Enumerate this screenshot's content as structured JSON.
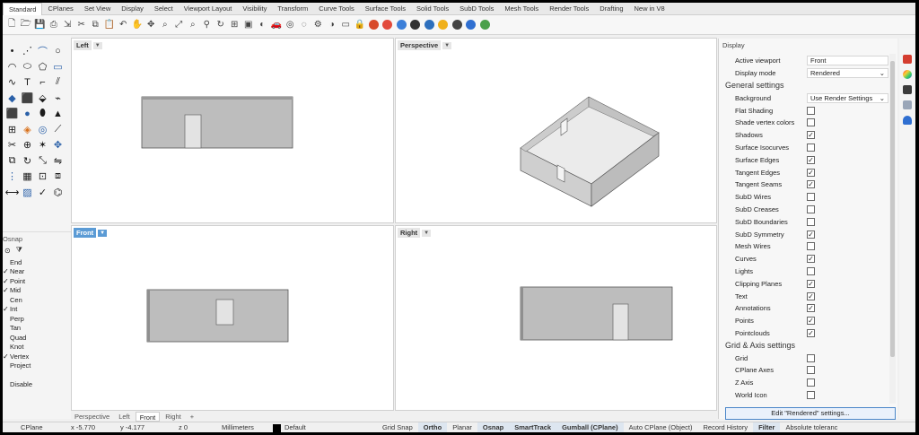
{
  "tabs": [
    "Standard",
    "CPlanes",
    "Set View",
    "Display",
    "Select",
    "Viewport Layout",
    "Visibility",
    "Transform",
    "Curve Tools",
    "Surface Tools",
    "Solid Tools",
    "SubD Tools",
    "Mesh Tools",
    "Render Tools",
    "Drafting",
    "New in V8"
  ],
  "active_tab": "Standard",
  "toolbar_icons": [
    "new-icon",
    "open-icon",
    "save-icon",
    "print-icon",
    "import-icon",
    "cut-icon",
    "copy-icon",
    "paste-icon",
    "undo-icon",
    "pan-icon",
    "move-icon",
    "zoom-window-icon",
    "zoom-extents-icon",
    "zoom-selected-icon",
    "zoom-icon",
    "rotate-view-icon",
    "four-viewports-icon",
    "named-view-icon",
    "shade-icon",
    "car-icon",
    "ghosted-icon",
    "wireframe-icon",
    "settings-icon",
    "hide-icon",
    "rectangle-icon",
    "lock-icon",
    "layer-icon",
    "material-icon",
    "render-icon",
    "light-icon",
    "environment-icon",
    "sun-icon",
    "color-icon",
    "help-icon",
    "options-icon"
  ],
  "left_tools": [
    "point-icon",
    "polyline-icon",
    "curve-icon",
    "circle-icon",
    "arc-icon",
    "ellipse-icon",
    "polygon-icon",
    "rectangle-icon",
    "freeform-icon",
    "text-icon",
    "fillet-icon",
    "offset-icon",
    "surface-icon",
    "extrude-icon",
    "loft-icon",
    "sweep-icon",
    "box-icon",
    "sphere-icon",
    "cylinder-icon",
    "cone-icon",
    "mesh-icon",
    "subd-icon",
    "boolean-icon",
    "split-icon",
    "trim-icon",
    "join-icon",
    "explode-icon",
    "move-icon",
    "copy-icon",
    "rotate-icon",
    "scale-icon",
    "mirror-icon",
    "array-icon",
    "grid-icon",
    "group-icon",
    "block-icon",
    "dimension-icon",
    "hatch-icon",
    "check-icon",
    "analyze-icon"
  ],
  "osnap": {
    "title": "Osnap",
    "items": [
      {
        "label": "End",
        "checked": false
      },
      {
        "label": "Near",
        "checked": true
      },
      {
        "label": "Point",
        "checked": true
      },
      {
        "label": "Mid",
        "checked": true
      },
      {
        "label": "Cen",
        "checked": false
      },
      {
        "label": "Int",
        "checked": true
      },
      {
        "label": "Perp",
        "checked": false
      },
      {
        "label": "Tan",
        "checked": false
      },
      {
        "label": "Quad",
        "checked": false
      },
      {
        "label": "Knot",
        "checked": false
      },
      {
        "label": "Vertex",
        "checked": true
      },
      {
        "label": "Project",
        "checked": false
      }
    ],
    "disable_label": "Disable"
  },
  "viewports": {
    "left": "Left",
    "perspective": "Perspective",
    "front": "Front",
    "right": "Right"
  },
  "viewport_tabs": [
    "Perspective",
    "Left",
    "Front",
    "Right"
  ],
  "active_viewport_tab": "Front",
  "display": {
    "title": "Display",
    "active_viewport_label": "Active viewport",
    "active_viewport": "Front",
    "display_mode_label": "Display mode",
    "display_mode": "Rendered",
    "general_settings": "General settings",
    "background_label": "Background",
    "background": "Use Render Settings",
    "general_options": [
      {
        "label": "Flat Shading",
        "checked": false
      },
      {
        "label": "Shade vertex colors",
        "checked": false
      },
      {
        "label": "Shadows",
        "checked": true
      },
      {
        "label": "Surface Isocurves",
        "checked": false
      },
      {
        "label": "Surface Edges",
        "checked": true
      },
      {
        "label": "Tangent Edges",
        "checked": true
      },
      {
        "label": "Tangent Seams",
        "checked": true
      },
      {
        "label": "SubD Wires",
        "checked": false
      },
      {
        "label": "SubD Creases",
        "checked": false
      },
      {
        "label": "SubD Boundaries",
        "checked": false
      },
      {
        "label": "SubD Symmetry",
        "checked": true
      },
      {
        "label": "Mesh Wires",
        "checked": false
      },
      {
        "label": "Curves",
        "checked": true
      },
      {
        "label": "Lights",
        "checked": false
      },
      {
        "label": "Clipping Planes",
        "checked": true
      },
      {
        "label": "Text",
        "checked": true
      },
      {
        "label": "Annotations",
        "checked": true
      },
      {
        "label": "Points",
        "checked": true
      },
      {
        "label": "Pointclouds",
        "checked": true
      }
    ],
    "grid_axis_settings": "Grid & Axis settings",
    "grid_options": [
      {
        "label": "Grid",
        "checked": false
      },
      {
        "label": "CPlane Axes",
        "checked": false
      },
      {
        "label": "Z Axis",
        "checked": false
      },
      {
        "label": "World Icon",
        "checked": false
      }
    ],
    "edit_button": "Edit \"Rendered\" settings..."
  },
  "status": {
    "cplane": "CPlane",
    "x": "x -5.770",
    "y": "y -4.177",
    "z": "z 0",
    "units": "Millimeters",
    "layer": "Default",
    "grid_snap": "Grid Snap",
    "ortho": "Ortho",
    "planar": "Planar",
    "osnap": "Osnap",
    "smarttrack": "SmartTrack",
    "gumball": "Gumball (CPlane)",
    "auto_cplane": "Auto CPlane (Object)",
    "record_history": "Record History",
    "filter": "Filter",
    "tolerance": "Absolute toleranc"
  }
}
